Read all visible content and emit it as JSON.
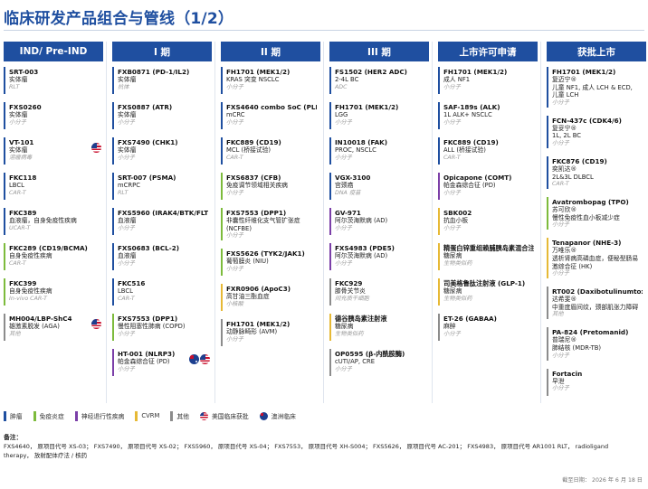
{
  "title": "临床研发产品组合与管线（1/2）",
  "colors": {
    "brand": "#1f4fa0",
    "tumor": "#1f4fa0",
    "immuno": "#7dbb3c",
    "neuro": "#7b3fa8",
    "cvrm": "#e6b936",
    "other": "#8c8c8c"
  },
  "columns": [
    {
      "header": "IND/ Pre-IND",
      "entries": [
        {
          "code": "SRT-003",
          "lines": [
            "实体瘤"
          ],
          "mod": "RLT",
          "color": "#1f4fa0"
        },
        {
          "code": "FXS0260",
          "lines": [
            "实体瘤"
          ],
          "mod": "小分子",
          "color": "#1f4fa0"
        },
        {
          "code": "VT-101",
          "lines": [
            "实体瘤"
          ],
          "mod": "溶瘤病毒",
          "color": "#1f4fa0",
          "flags": [
            "us"
          ]
        },
        {
          "code": "FKC118",
          "lines": [
            "LBCL"
          ],
          "mod": "CAR-T",
          "color": "#1f4fa0"
        },
        {
          "code": "FKC389",
          "lines": [
            "血液瘤，自身免疫性疾病"
          ],
          "mod": "UCAR-T",
          "color": "#1f4fa0"
        },
        {
          "code": "FKC289 (CD19/BCMA)",
          "lines": [
            "自身免疫性疾病"
          ],
          "mod": "CAR-T",
          "color": "#7dbb3c"
        },
        {
          "code": "FKC399",
          "lines": [
            "自身免疫性疾病"
          ],
          "mod": "In-vivo CAR-T",
          "color": "#7dbb3c"
        },
        {
          "code": "MH004/LBP-ShC4",
          "lines": [
            "雄激素脱发 (AGA)"
          ],
          "mod": "其他",
          "color": "#8c8c8c",
          "flags": [
            "us"
          ]
        }
      ]
    },
    {
      "header": "I 期",
      "entries": [
        {
          "code": "FXB0871 (PD-1/IL2)",
          "lines": [
            "实体瘤"
          ],
          "mod": "抗体",
          "color": "#1f4fa0"
        },
        {
          "code": "FXS0887 (ATR)",
          "lines": [
            "实体瘤"
          ],
          "mod": "小分子",
          "color": "#1f4fa0"
        },
        {
          "code": "FXS7490 (CHK1)",
          "lines": [
            "实体瘤"
          ],
          "mod": "小分子",
          "color": "#1f4fa0"
        },
        {
          "code": "SRT-007 (PSMA)",
          "lines": [
            "mCRPC"
          ],
          "mod": "RLT",
          "color": "#1f4fa0"
        },
        {
          "code": "FXS5960 (IRAK4/BTK/FLT3)",
          "lines": [
            "血液瘤"
          ],
          "mod": "小分子",
          "color": "#1f4fa0"
        },
        {
          "code": "FXS0683 (BCL-2)",
          "lines": [
            "血液瘤"
          ],
          "mod": "小分子",
          "color": "#1f4fa0"
        },
        {
          "code": "FKC516",
          "lines": [
            "LBCL"
          ],
          "mod": "CAR-T",
          "color": "#1f4fa0"
        },
        {
          "code": "FXS7553 (DPP1)",
          "lines": [
            "慢性阻塞性肺病 (COPD)"
          ],
          "mod": "小分子",
          "color": "#7dbb3c"
        },
        {
          "code": "HT-001 (NLRP3)",
          "lines": [
            "帕金森综合征 (PD)"
          ],
          "mod": "小分子",
          "color": "#7b3fa8",
          "flags": [
            "au",
            "us"
          ]
        }
      ]
    },
    {
      "header": "II 期",
      "entries": [
        {
          "code": "FH1701 (MEK1/2)",
          "lines": [
            "KRAS 突变 NSCLC"
          ],
          "mod": "小分子",
          "color": "#1f4fa0"
        },
        {
          "code": "FXS4640 combo SoC (PLK1)",
          "lines": [
            "mCRC"
          ],
          "mod": "小分子",
          "color": "#1f4fa0"
        },
        {
          "code": "FKC889 (CD19)",
          "lines": [
            "MCL (桥接试验)"
          ],
          "mod": "CAR-T",
          "color": "#1f4fa0"
        },
        {
          "code": "FXS6837 (CFB)",
          "lines": [
            "免疫调节领域相关疾病"
          ],
          "mod": "小分子",
          "color": "#7dbb3c"
        },
        {
          "code": "FXS7553 (DPP1)",
          "lines": [
            "非囊性纤维化支气管扩张症",
            "(NCFBE)"
          ],
          "mod": "小分子",
          "color": "#7dbb3c"
        },
        {
          "code": "FXS5626 (TYK2/JAK1)",
          "lines": [
            "葡萄膜炎 (NIU)"
          ],
          "mod": "小分子",
          "color": "#7dbb3c"
        },
        {
          "code": "FXR0906 (ApoC3)",
          "lines": [
            "高甘油三酯血症"
          ],
          "mod": "小核酸",
          "color": "#e6b936"
        },
        {
          "code": "FH1701 (MEK1/2)",
          "lines": [
            "动静脉畸形 (AVM)"
          ],
          "mod": "小分子",
          "color": "#8c8c8c"
        }
      ]
    },
    {
      "header": "III 期",
      "entries": [
        {
          "code": "FS1502 (HER2 ADC)",
          "lines": [
            "2-4L BC"
          ],
          "mod": "ADC",
          "color": "#1f4fa0"
        },
        {
          "code": "FH1701 (MEK1/2)",
          "lines": [
            "LGG"
          ],
          "mod": "小分子",
          "color": "#1f4fa0"
        },
        {
          "code": "IN10018 (FAK)",
          "lines": [
            "PROC, NSCLC"
          ],
          "mod": "小分子",
          "color": "#1f4fa0"
        },
        {
          "code": "VGX-3100",
          "lines": [
            "宫颈癌"
          ],
          "mod": "DNA 疫苗",
          "color": "#1f4fa0"
        },
        {
          "code": "GV-971",
          "lines": [
            "阿尔茨海默病 (AD)"
          ],
          "mod": "小分子",
          "color": "#7b3fa8"
        },
        {
          "code": "FXS4983 (PDE5)",
          "lines": [
            "阿尔茨海默病 (AD)"
          ],
          "mod": "小分子",
          "color": "#7b3fa8"
        },
        {
          "code": "FKC929",
          "lines": [
            "膝骨关节炎"
          ],
          "mod": "间充质干细胞",
          "color": "#8c8c8c"
        },
        {
          "code": "德谷胰岛素注射液",
          "lines": [
            "糖尿病"
          ],
          "mod": "生物类似药",
          "color": "#e6b936"
        },
        {
          "code": "OP0595 (β-内酰胺酶)",
          "lines": [
            "cUTI/AP, CRE"
          ],
          "mod": "小分子",
          "color": "#8c8c8c"
        }
      ]
    },
    {
      "header": "上市许可申请",
      "entries": [
        {
          "code": "FH1701 (MEK1/2)",
          "lines": [
            "成人 NF1"
          ],
          "mod": "小分子",
          "color": "#1f4fa0"
        },
        {
          "code": "SAF-189s (ALK)",
          "lines": [
            "1L ALK+ NSCLC"
          ],
          "mod": "小分子",
          "color": "#1f4fa0"
        },
        {
          "code": "FKC889 (CD19)",
          "lines": [
            "ALL (桥接试验)"
          ],
          "mod": "CAR-T",
          "color": "#1f4fa0"
        },
        {
          "code": "Opicapone (COMT)",
          "lines": [
            "帕金森综合征 (PD)"
          ],
          "mod": "小分子",
          "color": "#7b3fa8"
        },
        {
          "code": "SBK002",
          "lines": [
            "抗血小板"
          ],
          "mod": "小分子",
          "color": "#e6b936"
        },
        {
          "code": "精蛋白锌重组赖脯胰岛素混合注射液 (25R)",
          "lines": [
            "糖尿病"
          ],
          "mod": "生物类似药",
          "color": "#e6b936"
        },
        {
          "code": "司美格鲁肽注射液 (GLP-1)",
          "lines": [
            "糖尿病"
          ],
          "mod": "生物类似药",
          "color": "#e6b936"
        },
        {
          "code": "ET-26 (GABAA)",
          "lines": [
            "麻醉"
          ],
          "mod": "小分子",
          "color": "#8c8c8c"
        }
      ]
    },
    {
      "header": "获批上市",
      "entries": [
        {
          "code": "FH1701 (MEK1/2)",
          "lines": [
            "复迈宁®",
            "儿童 NF1, 成人 LCH & ECD,",
            "儿童 LCH"
          ],
          "mod": "小分子",
          "color": "#1f4fa0"
        },
        {
          "code": "FCN-437c (CDK4/6)",
          "lines": [
            "复妥宁®",
            "1L, 2L BC"
          ],
          "mod": "小分子",
          "color": "#1f4fa0"
        },
        {
          "code": "FKC876 (CD19)",
          "lines": [
            "奕凯达®",
            "2L&3L DLBCL"
          ],
          "mod": "CAR-T",
          "color": "#1f4fa0"
        },
        {
          "code": "Avatrombopag (TPO)",
          "lines": [
            "苏可欣®",
            "慢性免疫性血小板减少症"
          ],
          "mod": "小分子",
          "color": "#7dbb3c"
        },
        {
          "code": "Tenapanor (NHE-3)",
          "lines": [
            "万唯乐®",
            "透析肾病高磷血症，便秘型肠易",
            "激综合征 (HK)"
          ],
          "mod": "小分子",
          "color": "#e6b936"
        },
        {
          "code": "RT002 (DaxibotulinumtoxinA)",
          "lines": [
            "达希斐®",
            "中重度眉间纹，颈部肌张力障碍"
          ],
          "mod": "其他",
          "color": "#8c8c8c"
        },
        {
          "code": "PA-824 (Pretomanid)",
          "lines": [
            "普瑞尼®",
            "肺结核 (MDR-TB)"
          ],
          "mod": "小分子",
          "color": "#8c8c8c"
        },
        {
          "code": "Fortacin",
          "lines": [
            "早泄"
          ],
          "mod": "小分子",
          "color": "#8c8c8c"
        }
      ]
    }
  ],
  "legend": [
    {
      "label": "肿瘤",
      "color": "#1f4fa0",
      "kind": "swatch"
    },
    {
      "label": "免疫炎症",
      "color": "#7dbb3c",
      "kind": "swatch"
    },
    {
      "label": "神经退行性疾病",
      "color": "#7b3fa8",
      "kind": "swatch"
    },
    {
      "label": "CVRM",
      "color": "#e6b936",
      "kind": "swatch"
    },
    {
      "label": "其他",
      "color": "#8c8c8c",
      "kind": "swatch"
    },
    {
      "label": "美国临床获批",
      "kind": "us"
    },
    {
      "label": "澳洲临床",
      "kind": "au"
    }
  ],
  "notes_label": "备注：",
  "notes": "FXS4640， 原项目代号 XS-03； FXS7490， 原项目代号 XS-02； FXS5960， 原项目代号 XS-04； FXS7553， 原项目代号 XH-S004； FXS5626， 原项目代号 AC-201； FXS4983， 原项目代号 AR1001 RLT， radioligand therapy， 放射配体疗法 / 核药",
  "footer_date": "截至日期： 2026 年 6 月 18 日"
}
